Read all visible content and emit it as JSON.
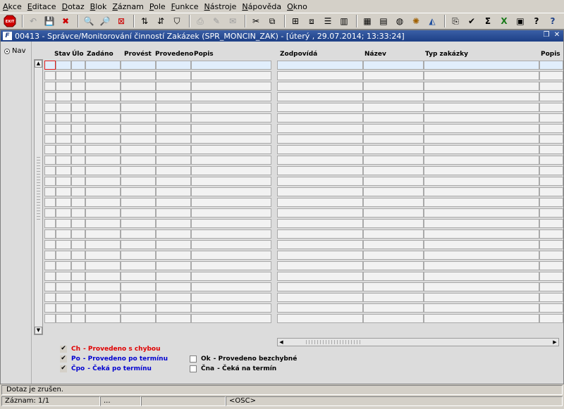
{
  "menu": [
    {
      "label": "Akce"
    },
    {
      "label": "Editace"
    },
    {
      "label": "Dotaz"
    },
    {
      "label": "Blok"
    },
    {
      "label": "Záznam"
    },
    {
      "label": "Pole"
    },
    {
      "label": "Funkce"
    },
    {
      "label": "Nástroje"
    },
    {
      "label": "Nápověda"
    },
    {
      "label": "Okno"
    }
  ],
  "toolbar": {
    "exit_label": "EXIT",
    "icons": [
      "save-icon",
      "print-icon",
      "find-icon",
      "clear-icon",
      "sort-icon",
      "filter-icon",
      "cut-icon",
      "copy-icon",
      "paste-icon",
      "sum-icon",
      "excel-icon",
      "help-icon"
    ]
  },
  "window": {
    "icon_letter": "F",
    "title": "00413 - Správce/Monitorování činností Zakázek (SPR_MONCIN_ZAK) - [úterý  , 29.07.2014; 13:33:24]"
  },
  "nav": {
    "label": "Nav"
  },
  "columns": [
    {
      "label": "Stav"
    },
    {
      "label": "Úlo"
    },
    {
      "label": "Zadáno"
    },
    {
      "label": "Provést"
    },
    {
      "label": "Provedeno"
    },
    {
      "label": "Popis"
    },
    {
      "label": "Zodpovídá"
    },
    {
      "label": "Název"
    },
    {
      "label": "Typ zakázky"
    },
    {
      "label": "Popis"
    }
  ],
  "legend": [
    {
      "code": "Ch",
      "text": "- Provedeno s chybou",
      "checked": true,
      "color": "#e00000"
    },
    {
      "code": "Po",
      "text": "- Provedeno po termínu",
      "checked": true,
      "color": "#0000d0"
    },
    {
      "code": "Čpo",
      "text": "- Čeká po termínu",
      "checked": true,
      "color": "#0000d0"
    },
    {
      "code": "Ok",
      "text": "- Provedeno bezchybné",
      "checked": false,
      "color": "#000000"
    },
    {
      "code": "Čna",
      "text": "- Čeká na termín",
      "checked": false,
      "color": "#000000"
    }
  ],
  "status": {
    "message": "Dotaz je zrušen.",
    "record": "Záznam: 1/1",
    "seg2": "...",
    "seg3": "",
    "mode": "<OSC>"
  }
}
